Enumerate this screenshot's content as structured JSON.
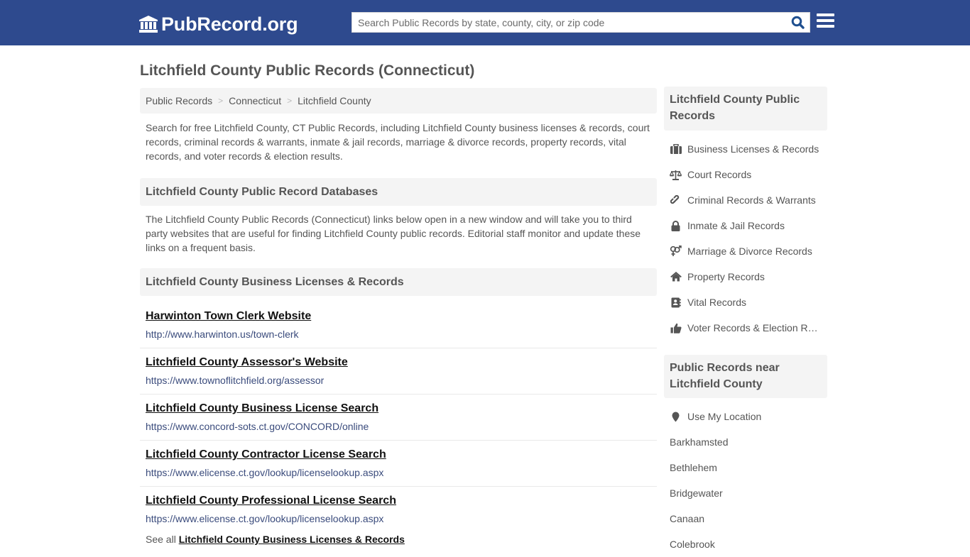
{
  "header": {
    "logo_text": "PubRecord.org",
    "search_placeholder": "Search Public Records by state, county, city, or zip code",
    "colors": {
      "nav_bg": "#2e4a8e",
      "search_icon": "#1f4f8f"
    }
  },
  "page": {
    "title": "Litchfield County Public Records (Connecticut)",
    "breadcrumb": [
      "Public Records",
      "Connecticut",
      "Litchfield County"
    ],
    "intro": "Search for free Litchfield County, CT Public Records, including Litchfield County business licenses & records, court records, criminal records & warrants, inmate & jail records, marriage & divorce records, property records, vital records, and voter records & election results."
  },
  "databases": {
    "heading": "Litchfield County Public Record Databases",
    "intro": "The Litchfield County Public Records (Connecticut) links below open in a new window and will take you to third party websites that are useful for finding Litchfield County public records. Editorial staff monitor and update these links on a frequent basis."
  },
  "business": {
    "heading": "Litchfield County Business Licenses & Records",
    "links": [
      {
        "title": "Harwinton Town Clerk Website",
        "url": "http://www.harwinton.us/town-clerk"
      },
      {
        "title": "Litchfield County Assessor's Website",
        "url": "https://www.townoflitchfield.org/assessor"
      },
      {
        "title": "Litchfield County Business License Search",
        "url": "https://www.concord-sots.ct.gov/CONCORD/online"
      },
      {
        "title": "Litchfield County Contractor License Search",
        "url": "https://www.elicense.ct.gov/lookup/licenselookup.aspx"
      },
      {
        "title": "Litchfield County Professional License Search",
        "url": "https://www.elicense.ct.gov/lookup/licenselookup.aspx"
      }
    ],
    "see_all_prefix": "See all",
    "see_all_link": "Litchfield County Business Licenses & Records"
  },
  "sidebar": {
    "records_heading": "Litchfield County Public Records",
    "records": [
      {
        "label": "Business Licenses & Records",
        "icon": "briefcase-icon"
      },
      {
        "label": "Court Records",
        "icon": "balance-scale-icon"
      },
      {
        "label": "Criminal Records & Warrants",
        "icon": "link-icon"
      },
      {
        "label": "Inmate & Jail Records",
        "icon": "lock-icon"
      },
      {
        "label": "Marriage & Divorce Records",
        "icon": "venus-mars-icon"
      },
      {
        "label": "Property Records",
        "icon": "home-icon"
      },
      {
        "label": "Vital Records",
        "icon": "address-book-icon"
      },
      {
        "label": "Voter Records & Election Results",
        "icon": "thumbs-up-icon"
      }
    ],
    "nearby_heading": "Public Records near Litchfield County",
    "use_location": "Use My Location",
    "nearby": [
      "Barkhamsted",
      "Bethlehem",
      "Bridgewater",
      "Canaan",
      "Colebrook"
    ]
  }
}
